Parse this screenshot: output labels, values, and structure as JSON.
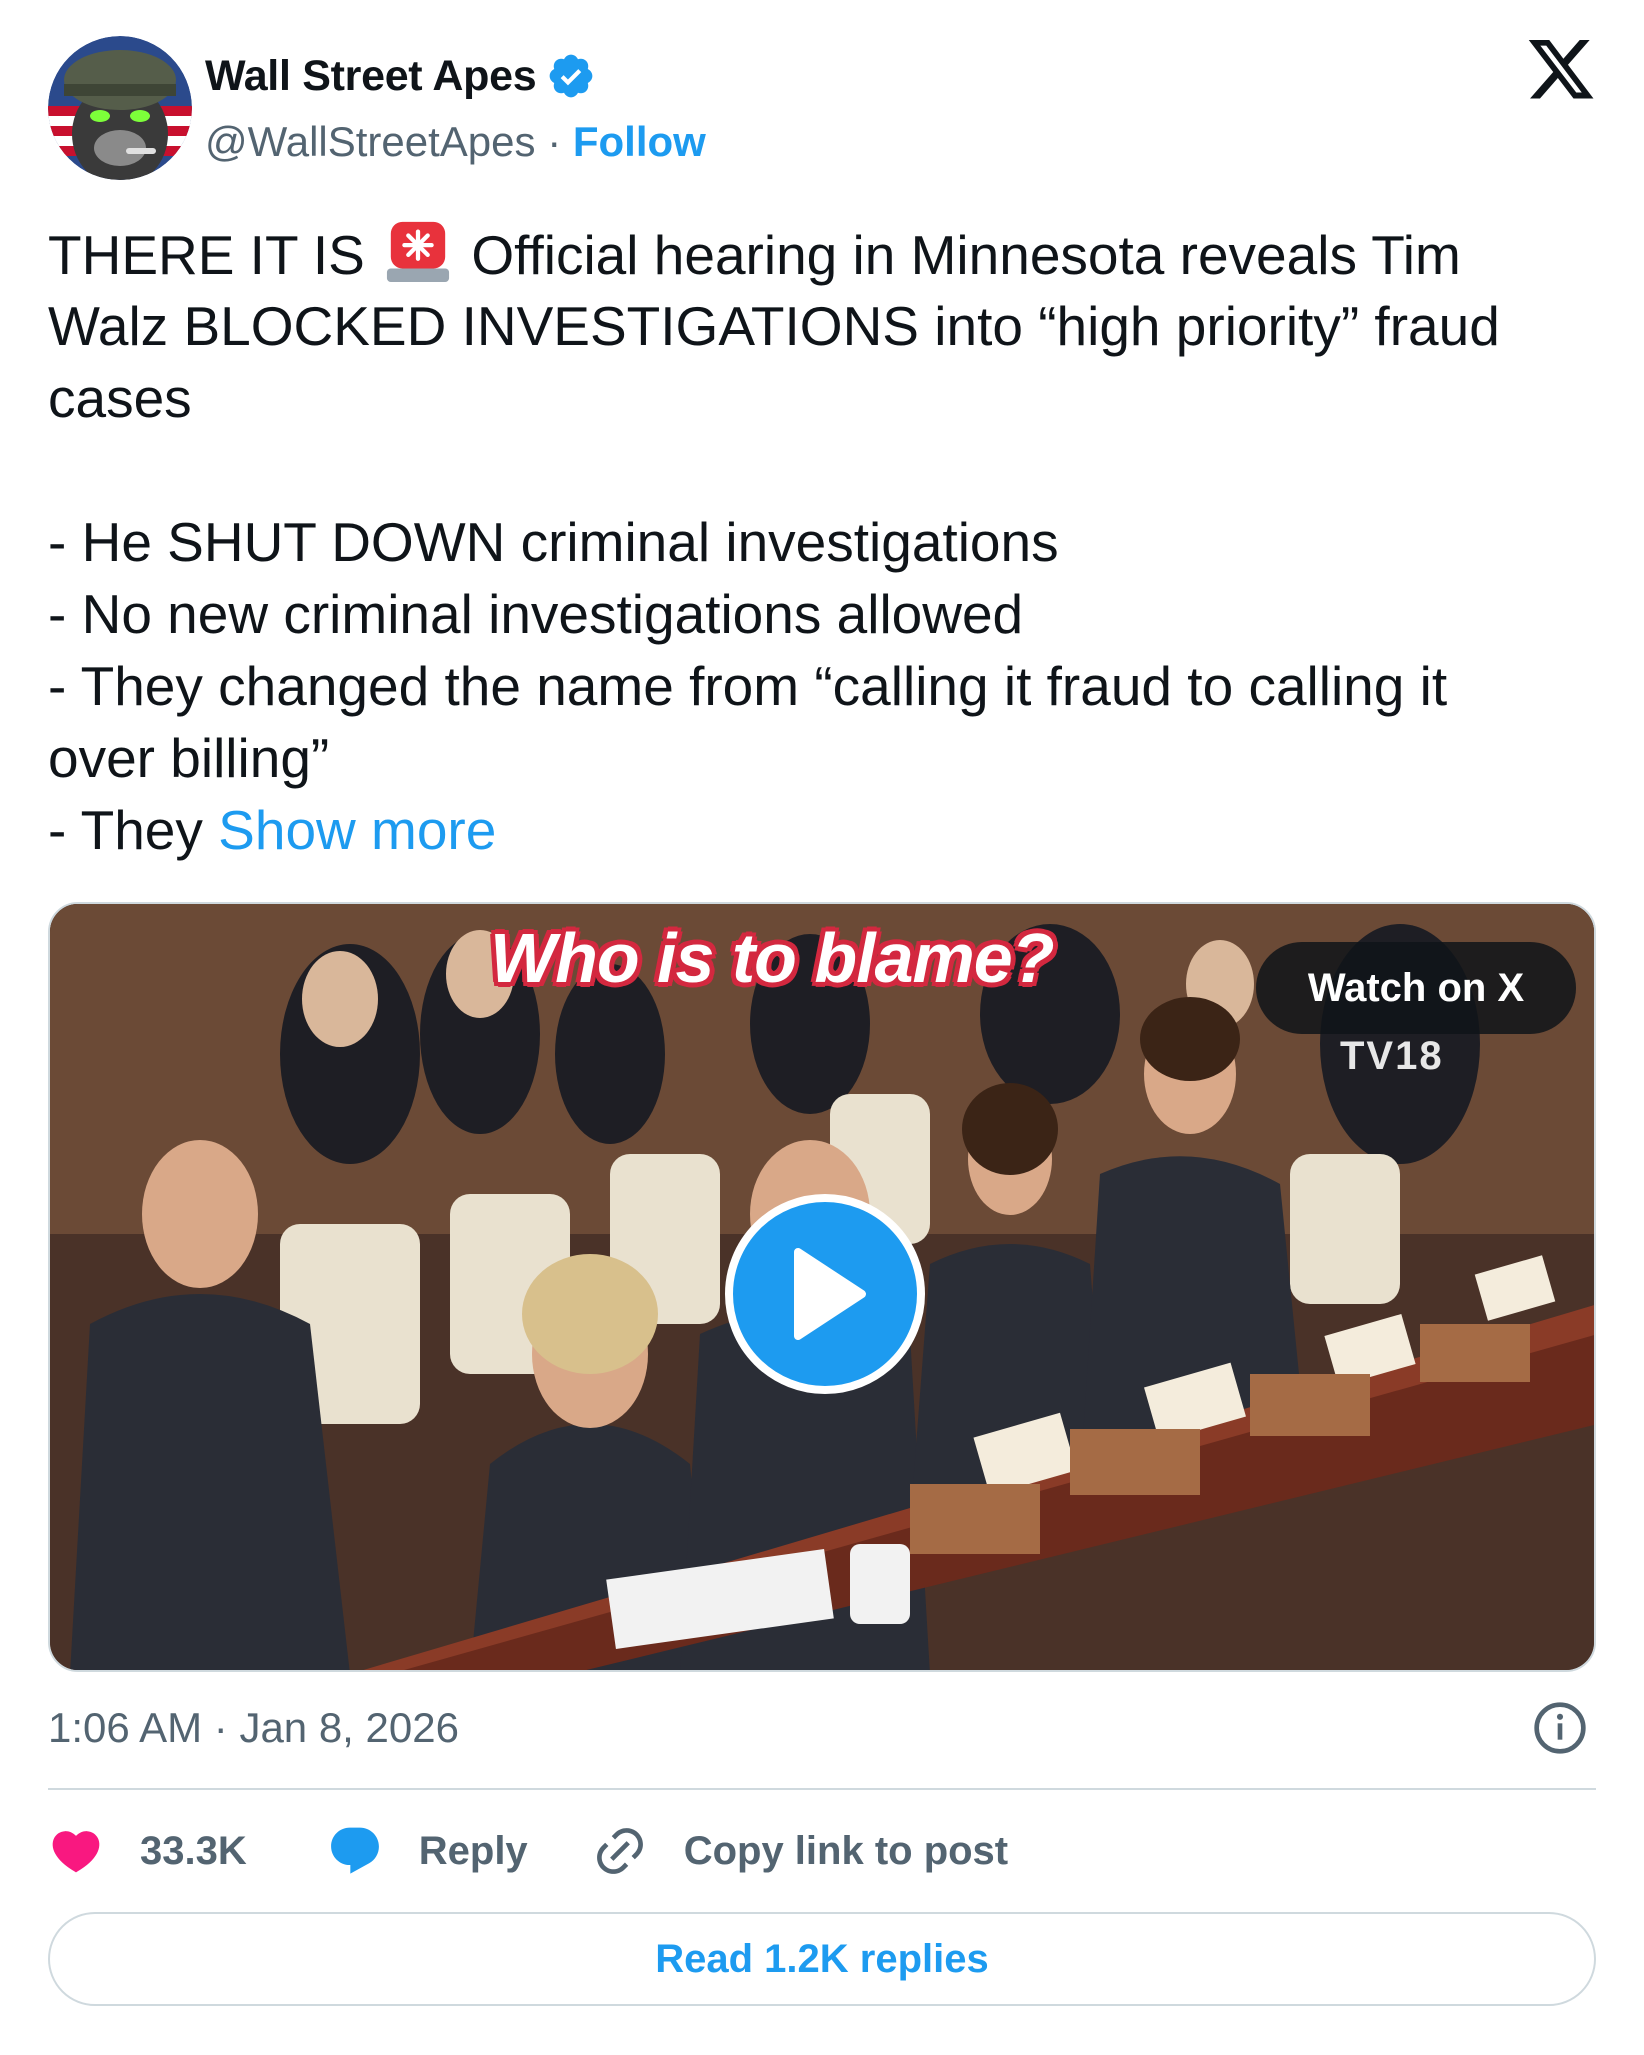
{
  "author": {
    "name": "Wall Street Apes",
    "handle": "@WallStreetApes",
    "separator": "·",
    "follow_label": "Follow",
    "verified": true
  },
  "platform_logo": "x-logo",
  "tweet": {
    "lines": [
      [
        "THERE IT IS ",
        "siren-emoji",
        " Official hearing in Minnesota reveals Tim"
      ],
      "Walz BLOCKED INVESTIGATIONS into “high priority” fraud",
      "cases",
      "",
      "- He SHUT DOWN criminal investigations",
      "- No new criminal investigations allowed",
      "- They changed the name from “calling it fraud to calling it",
      "over billing”",
      "- They "
    ],
    "line1_pre": "THERE IT IS",
    "line1_post": "Official hearing in Minnesota reveals Tim",
    "line2": "Walz BLOCKED INVESTIGATIONS into “high priority” fraud",
    "line3": "cases",
    "line5": "- He SHUT DOWN criminal investigations",
    "line6": "- No new criminal investigations allowed",
    "line7": "- They changed the name from “calling it fraud to calling it",
    "line8": "over billing”",
    "line9": "- They",
    "show_more": "Show more"
  },
  "media": {
    "overlay_title": "Who is to blame?",
    "watch_label": "Watch on X",
    "channel_text": "TV18",
    "icon": "play-icon"
  },
  "meta": {
    "time": "1:06 AM",
    "separator": "·",
    "date": "Jan 8, 2026",
    "info_icon": "info-icon"
  },
  "actions": {
    "like_count": "33.3K",
    "reply_label": "Reply",
    "copy_label": "Copy link to post"
  },
  "read_replies_label": "Read 1.2K replies",
  "colors": {
    "accent": "#1d9bf0",
    "like": "#f91880",
    "text": "#0f1419",
    "muted": "#536471",
    "border": "#cfd9de"
  }
}
